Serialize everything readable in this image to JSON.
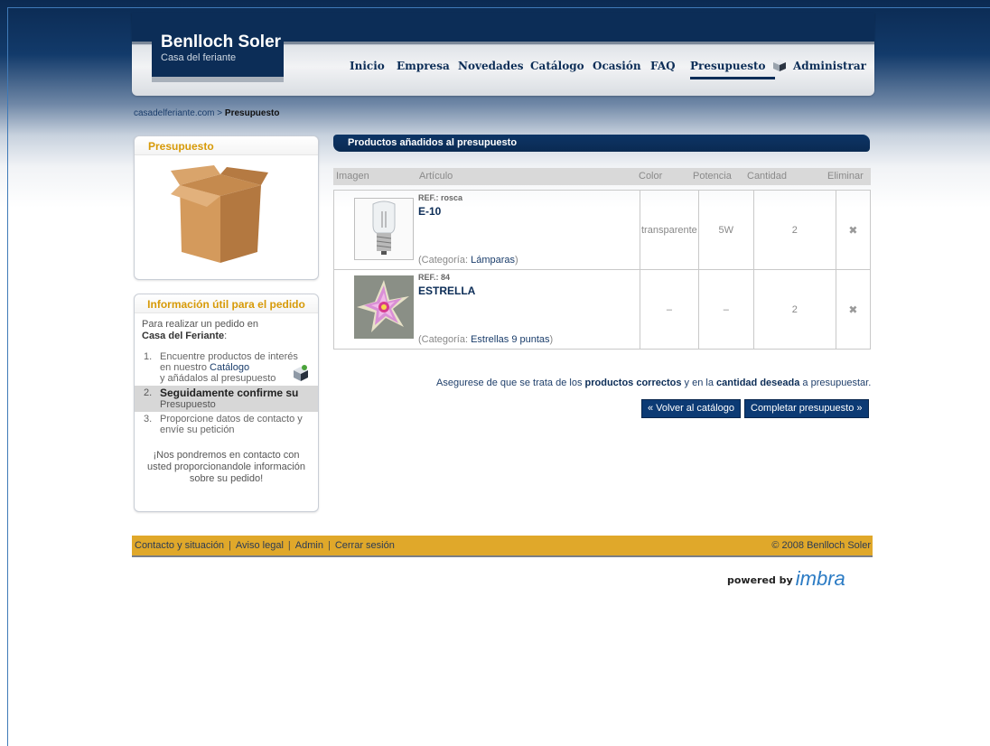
{
  "header": {
    "logo_name": "Benlloch Soler",
    "logo_sub": "Casa del feriante",
    "nav": [
      "Inicio",
      "Empresa",
      "Novedades",
      "Catálogo",
      "Ocasión",
      "FAQ",
      "Presupuesto",
      "Administrar"
    ],
    "active_nav": "Presupuesto"
  },
  "breadcrumb": {
    "site": "casadelferiante.com",
    "sep": " > ",
    "current": "Presupuesto"
  },
  "sidebar": {
    "quote_title": "Presupuesto",
    "info_title": "Información útil para el pedido",
    "intro": "Para realizar un pedido en",
    "intro_bold": "Casa del Feriante",
    "intro_end": ":",
    "step1_num": "1.",
    "step1_a": "Encuentre productos de interés en nuestro",
    "step1_link": "Catálogo",
    "step1_b": "y añádalos al presupuesto",
    "step2_num": "2.",
    "step2_bold": "Seguidamente confirme su",
    "step2_rest": "Presupuesto",
    "step3_num": "3.",
    "step3": "Proporcione datos de contacto y envíe su petición",
    "closing": "¡Nos pondremos en contacto con usted proporcionandole información sobre su pedido!"
  },
  "main": {
    "title": "Productos añadidos al presupuesto",
    "columns": [
      "Imagen",
      "Artículo",
      "Color",
      "Potencia",
      "Cantidad",
      "Eliminar"
    ],
    "category_label": "(Categoría: ",
    "category_close": ")",
    "delete_glyph": "✖",
    "products": [
      {
        "ref": "REF.: rosca",
        "name": "E-10",
        "category": "Lámparas",
        "color": "transparente",
        "power": "5W",
        "quantity": "2"
      },
      {
        "ref": "REF.: 84",
        "name": "ESTRELLA",
        "category": "Estrellas 9 puntas",
        "color": "–",
        "power": "–",
        "quantity": "2"
      }
    ],
    "notice_a": "Asegurese de que se trata de los",
    "notice_b": "productos correctos",
    "notice_c": "y en la",
    "notice_d": "cantidad deseada",
    "notice_e": "a presupuestar.",
    "back_button": "« Volver al catálogo",
    "complete_button": "Completar presupuesto »"
  },
  "footer": {
    "links": [
      "Contacto y situación",
      "Aviso legal",
      "Admin",
      "Cerrar sesión"
    ],
    "separator": "|",
    "copyright": "© 2008 Benlloch Soler",
    "powered_by": "powered by",
    "powered_logo": "imbra"
  },
  "icons": {
    "cube": "cube-icon",
    "box": "cardboard-box-image",
    "delete": "delete-x-icon",
    "bulb": "bulb-thumbnail",
    "star": "star-thumbnail"
  },
  "colors": {
    "navy": "#0c2d57",
    "gold": "#d79a08",
    "footer": "#e0a82a"
  }
}
